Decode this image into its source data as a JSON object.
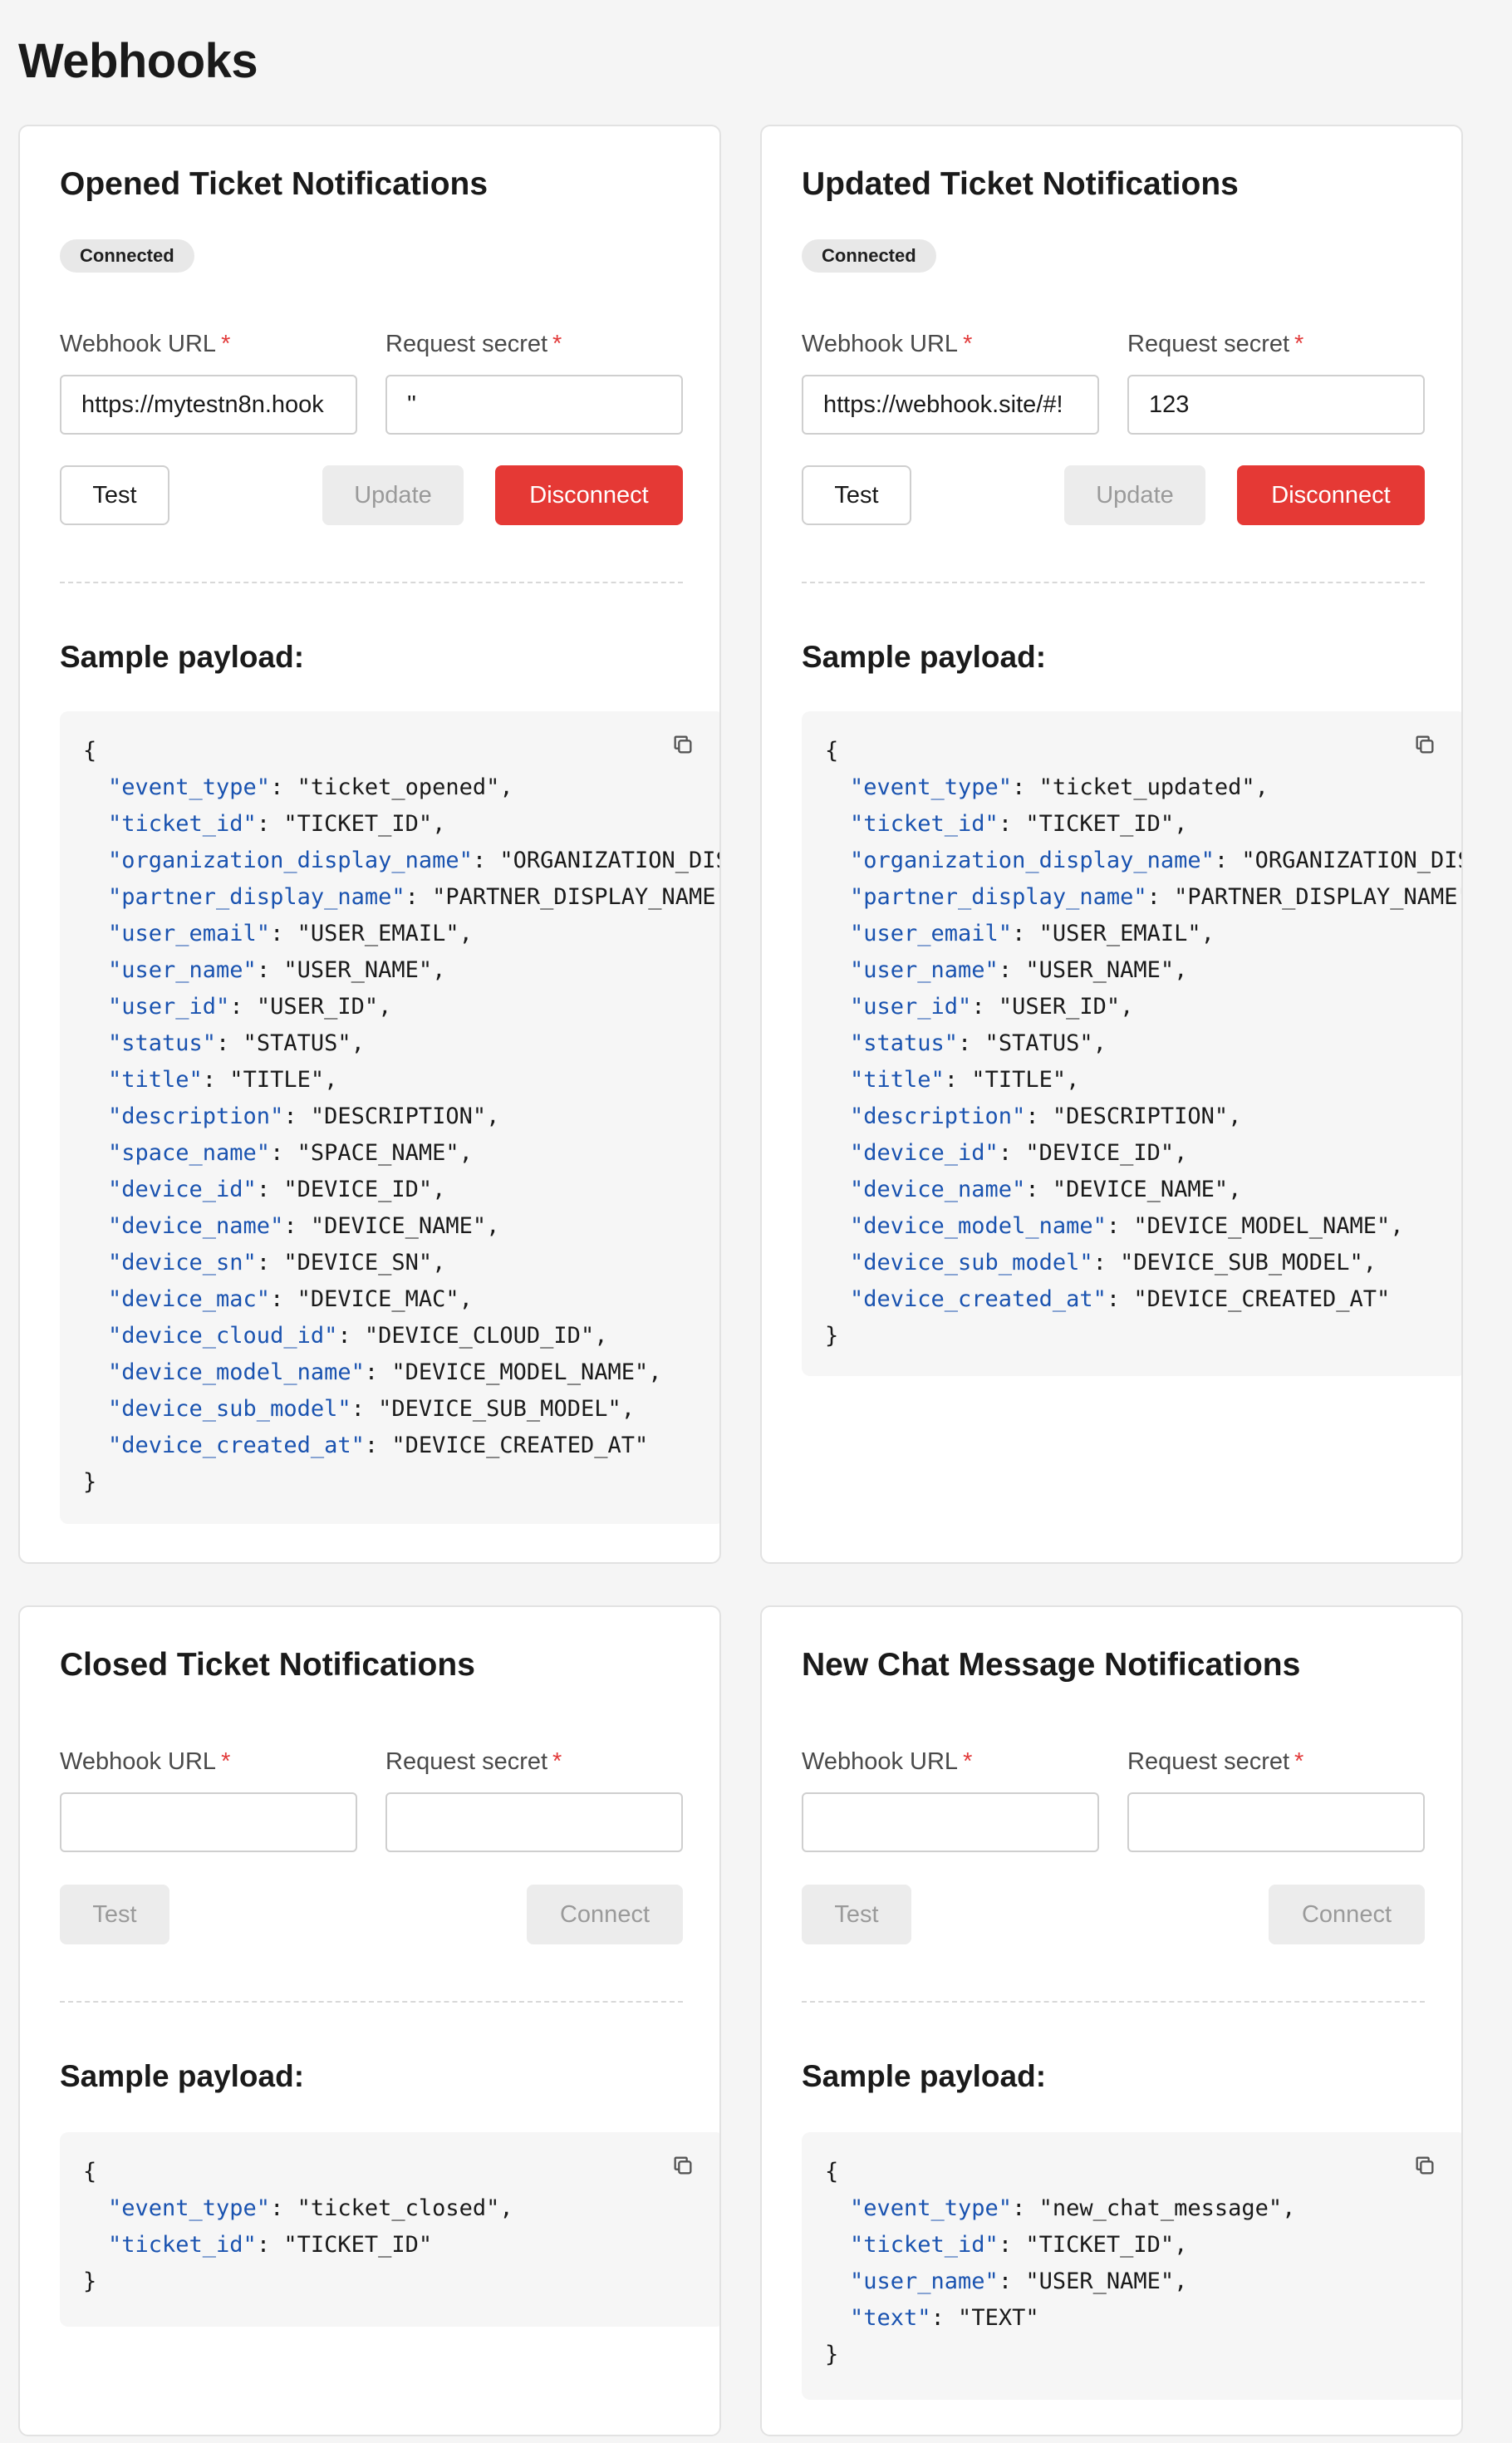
{
  "page": {
    "title": "Webhooks"
  },
  "labels": {
    "webhook_url": "Webhook URL",
    "request_secret": "Request secret",
    "required_mark": "*",
    "sample_payload": "Sample payload:"
  },
  "cards": [
    {
      "title": "Opened Ticket Notifications",
      "status": "Connected",
      "url_value": "https://mytestn8n.hook",
      "secret_value": "''",
      "buttons": {
        "test": "Test",
        "update": "Update",
        "disconnect": "Disconnect"
      },
      "payload": [
        {
          "key": "event_type",
          "value": "ticket_opened"
        },
        {
          "key": "ticket_id",
          "value": "TICKET_ID"
        },
        {
          "key": "organization_display_name",
          "value": "ORGANIZATION_DISP"
        },
        {
          "key": "partner_display_name",
          "value": "PARTNER_DISPLAY_NAME"
        },
        {
          "key": "user_email",
          "value": "USER_EMAIL"
        },
        {
          "key": "user_name",
          "value": "USER_NAME"
        },
        {
          "key": "user_id",
          "value": "USER_ID"
        },
        {
          "key": "status",
          "value": "STATUS"
        },
        {
          "key": "title",
          "value": "TITLE"
        },
        {
          "key": "description",
          "value": "DESCRIPTION"
        },
        {
          "key": "space_name",
          "value": "SPACE_NAME"
        },
        {
          "key": "device_id",
          "value": "DEVICE_ID"
        },
        {
          "key": "device_name",
          "value": "DEVICE_NAME"
        },
        {
          "key": "device_sn",
          "value": "DEVICE_SN"
        },
        {
          "key": "device_mac",
          "value": "DEVICE_MAC"
        },
        {
          "key": "device_cloud_id",
          "value": "DEVICE_CLOUD_ID"
        },
        {
          "key": "device_model_name",
          "value": "DEVICE_MODEL_NAME"
        },
        {
          "key": "device_sub_model",
          "value": "DEVICE_SUB_MODEL"
        },
        {
          "key": "device_created_at",
          "value": "DEVICE_CREATED_AT"
        }
      ]
    },
    {
      "title": "Updated Ticket Notifications",
      "status": "Connected",
      "url_value": "https://webhook.site/#!",
      "secret_value": "123",
      "buttons": {
        "test": "Test",
        "update": "Update",
        "disconnect": "Disconnect"
      },
      "payload": [
        {
          "key": "event_type",
          "value": "ticket_updated"
        },
        {
          "key": "ticket_id",
          "value": "TICKET_ID"
        },
        {
          "key": "organization_display_name",
          "value": "ORGANIZATION_DISP"
        },
        {
          "key": "partner_display_name",
          "value": "PARTNER_DISPLAY_NAME"
        },
        {
          "key": "user_email",
          "value": "USER_EMAIL"
        },
        {
          "key": "user_name",
          "value": "USER_NAME"
        },
        {
          "key": "user_id",
          "value": "USER_ID"
        },
        {
          "key": "status",
          "value": "STATUS"
        },
        {
          "key": "title",
          "value": "TITLE"
        },
        {
          "key": "description",
          "value": "DESCRIPTION"
        },
        {
          "key": "device_id",
          "value": "DEVICE_ID"
        },
        {
          "key": "device_name",
          "value": "DEVICE_NAME"
        },
        {
          "key": "device_model_name",
          "value": "DEVICE_MODEL_NAME"
        },
        {
          "key": "device_sub_model",
          "value": "DEVICE_SUB_MODEL"
        },
        {
          "key": "device_created_at",
          "value": "DEVICE_CREATED_AT"
        }
      ]
    },
    {
      "title": "Closed Ticket Notifications",
      "url_value": "",
      "secret_value": "",
      "buttons": {
        "test": "Test",
        "connect": "Connect"
      },
      "payload": [
        {
          "key": "event_type",
          "value": "ticket_closed"
        },
        {
          "key": "ticket_id",
          "value": "TICKET_ID"
        }
      ]
    },
    {
      "title": "New Chat Message Notifications",
      "url_value": "",
      "secret_value": "",
      "buttons": {
        "test": "Test",
        "connect": "Connect"
      },
      "payload": [
        {
          "key": "event_type",
          "value": "new_chat_message"
        },
        {
          "key": "ticket_id",
          "value": "TICKET_ID"
        },
        {
          "key": "user_name",
          "value": "USER_NAME"
        },
        {
          "key": "text",
          "value": "TEXT"
        }
      ]
    }
  ],
  "icons": {
    "copy": "copy-icon"
  }
}
